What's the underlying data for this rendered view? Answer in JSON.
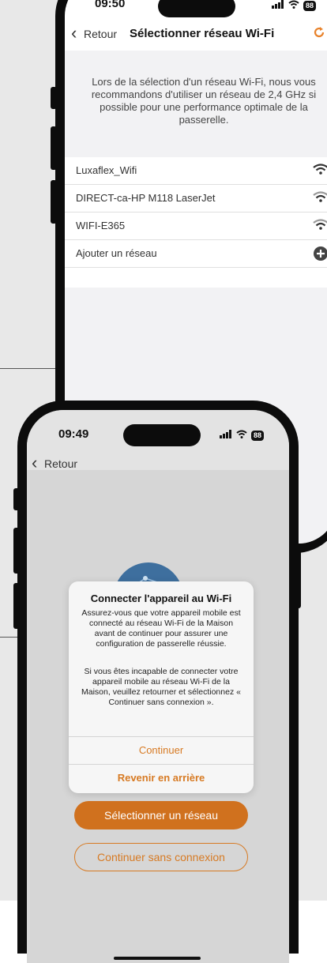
{
  "back_phone": {
    "status": {
      "time": "09:50",
      "battery": "88"
    },
    "nav": {
      "back_label": "Retour",
      "title": "Sélectionner réseau Wi-Fi"
    },
    "info_text": "Lors de la sélection d'un réseau Wi-Fi, nous vous recommandons d'utiliser un réseau de 2,4 GHz si possible pour une performance optimale de la passerelle.",
    "networks": [
      {
        "label": "Luxaflex_Wifi",
        "icon": "wifi-icon"
      },
      {
        "label": "DIRECT-ca-HP M118 LaserJet",
        "icon": "wifi-icon"
      },
      {
        "label": "WIFI-E365",
        "icon": "wifi-icon"
      },
      {
        "label": "Ajouter un réseau",
        "icon": "add-icon"
      }
    ],
    "colors": {
      "accent": "#e8822b"
    }
  },
  "front_phone": {
    "status": {
      "time": "09:49",
      "battery": "88"
    },
    "nav": {
      "back_label": "Retour"
    },
    "dialog": {
      "title": "Connecter l'appareil au Wi-Fi",
      "body1": "Assurez-vous que votre appareil mobile est connecté au réseau Wi-Fi de la Maison avant de continuer pour assurer une configuration de passerelle réussie.",
      "body2": "Si vous êtes incapable de connecter votre appareil mobile au réseau Wi-Fi de la Maison, veuillez retourner et sélectionnez « Continuer sans connexion ».",
      "continue_label": "Continuer",
      "back_label": "Revenir en arrière"
    },
    "select_network_label": "Sélectionner un réseau",
    "continue_offline_label": "Continuer sans connexion",
    "colors": {
      "accent": "#d0711e",
      "globe": "#3e6f9e"
    }
  }
}
